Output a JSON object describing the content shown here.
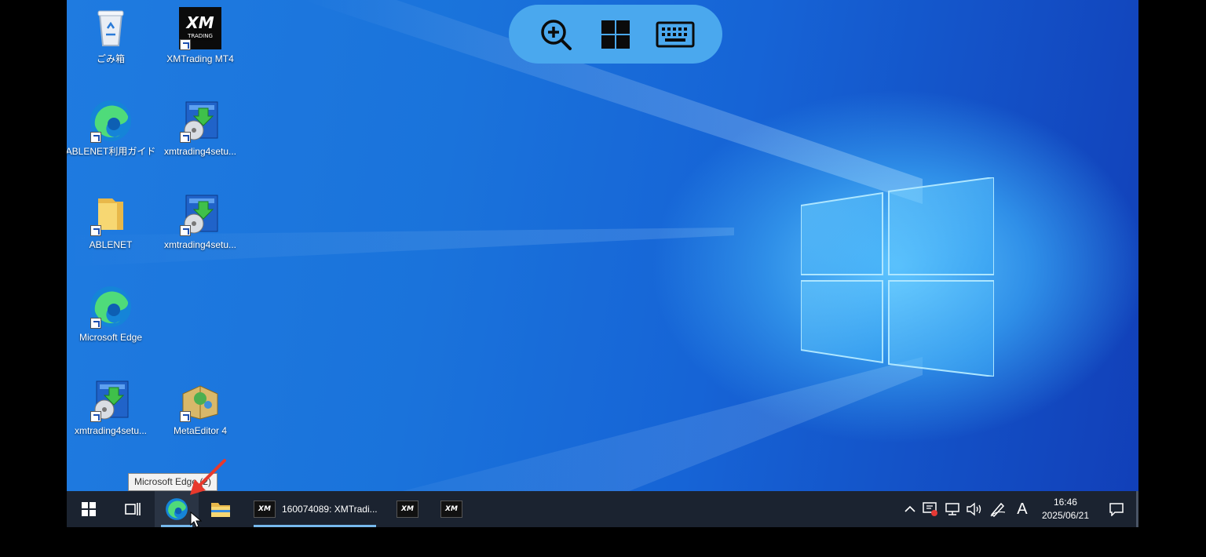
{
  "toolbar": {
    "zoom_icon": "zoom-in-icon",
    "start_icon": "windows-icon",
    "keyboard_icon": "keyboard-icon"
  },
  "desktop": {
    "icons": [
      {
        "label": "ごみ箱",
        "icon": "recycle-bin-icon"
      },
      {
        "label": "XMTrading MT4",
        "icon": "xm-trading-icon"
      },
      {
        "label": "ABLENET利用ガイド",
        "icon": "edge-icon"
      },
      {
        "label": "xmtrading4setu...",
        "icon": "setup-installer-icon"
      },
      {
        "label": "ABLENET",
        "icon": "folder-icon"
      },
      {
        "label": "xmtrading4setu...",
        "icon": "setup-installer-icon"
      },
      {
        "label": "Microsoft Edge",
        "icon": "edge-icon"
      },
      {
        "label": "xmtrading4setu...",
        "icon": "setup-installer-icon"
      },
      {
        "label": "MetaEditor 4",
        "icon": "metaeditor-icon"
      }
    ]
  },
  "tooltip": {
    "text": "Microsoft Edge (2)"
  },
  "taskbar": {
    "window_label": "160074089: XMTradi...",
    "xm_badge": "XM"
  },
  "tray": {
    "ime": "A",
    "time": "16:46",
    "date": "2025/06/21"
  },
  "colors": {
    "desktop": "#1a73db",
    "taskbar": "#1b2330",
    "toolbar": "#4aa8ee",
    "pointer_arrow": "#e8392c"
  }
}
